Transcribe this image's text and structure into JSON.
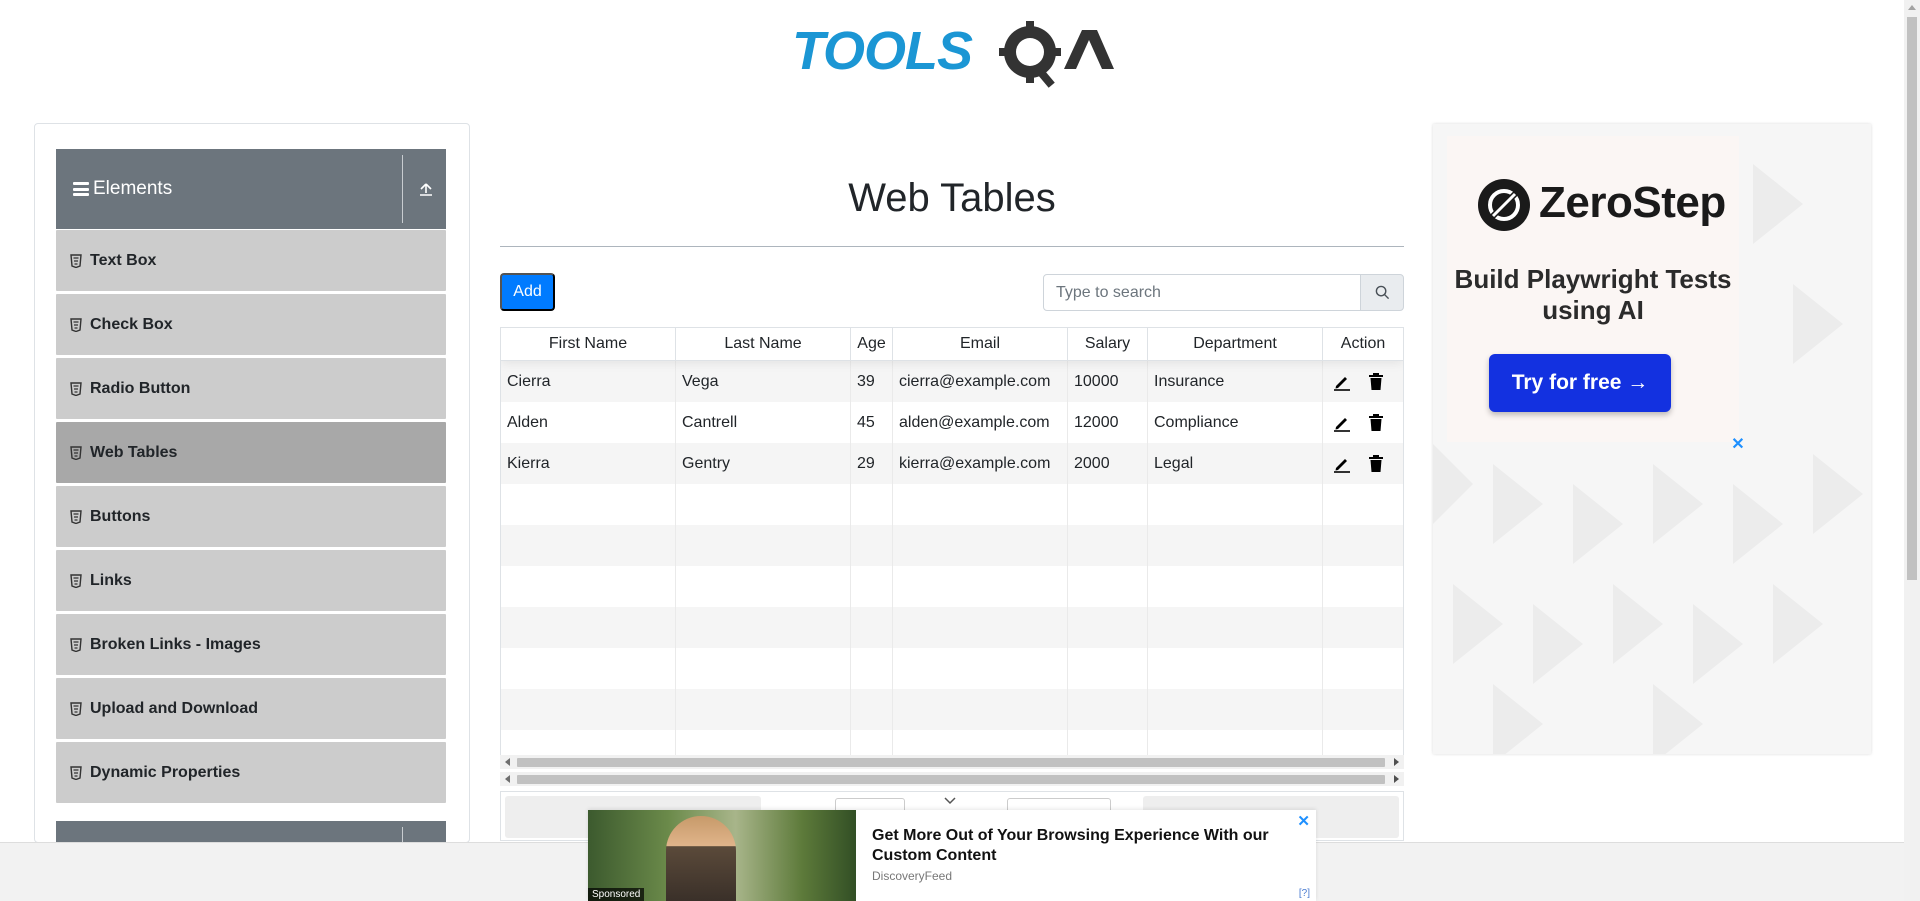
{
  "header": {
    "logo_text": "TOOLSQA"
  },
  "sidebar": {
    "group_title": "Elements",
    "items": [
      {
        "label": "Text Box"
      },
      {
        "label": "Check Box"
      },
      {
        "label": "Radio Button"
      },
      {
        "label": "Web Tables",
        "active": true
      },
      {
        "label": "Buttons"
      },
      {
        "label": "Links"
      },
      {
        "label": "Broken Links - Images"
      },
      {
        "label": "Upload and Download"
      },
      {
        "label": "Dynamic Properties"
      }
    ]
  },
  "main": {
    "title": "Web Tables",
    "add_label": "Add",
    "search": {
      "placeholder": "Type to search",
      "value": ""
    },
    "table": {
      "columns": [
        "First Name",
        "Last Name",
        "Age",
        "Email",
        "Salary",
        "Department",
        "Action"
      ],
      "rows": [
        [
          "Cierra",
          "Vega",
          "39",
          "cierra@example.com",
          "10000",
          "Insurance"
        ],
        [
          "Alden",
          "Cantrell",
          "45",
          "alden@example.com",
          "12000",
          "Compliance"
        ],
        [
          "Kierra",
          "Gentry",
          "29",
          "kierra@example.com",
          "2000",
          "Legal"
        ]
      ]
    }
  },
  "ad_right": {
    "brand": "ZeroStep",
    "headline": "Build Playwright Tests using AI",
    "cta": "Try for free →",
    "close": "✕"
  },
  "ad_bottom": {
    "headline": "Get More Out of Your Browsing Experience With our Custom Content",
    "source": "DiscoveryFeed",
    "sponsored": "Sponsored",
    "info": "[?]",
    "close": "✕"
  },
  "colors": {
    "primary": "#007bff",
    "sidebar_header": "#6c757d",
    "menu_item": "#cccccc",
    "menu_item_active": "#a8a8a8",
    "logo_blue": "#1b96d4",
    "ad_cta": "#1331e0"
  }
}
